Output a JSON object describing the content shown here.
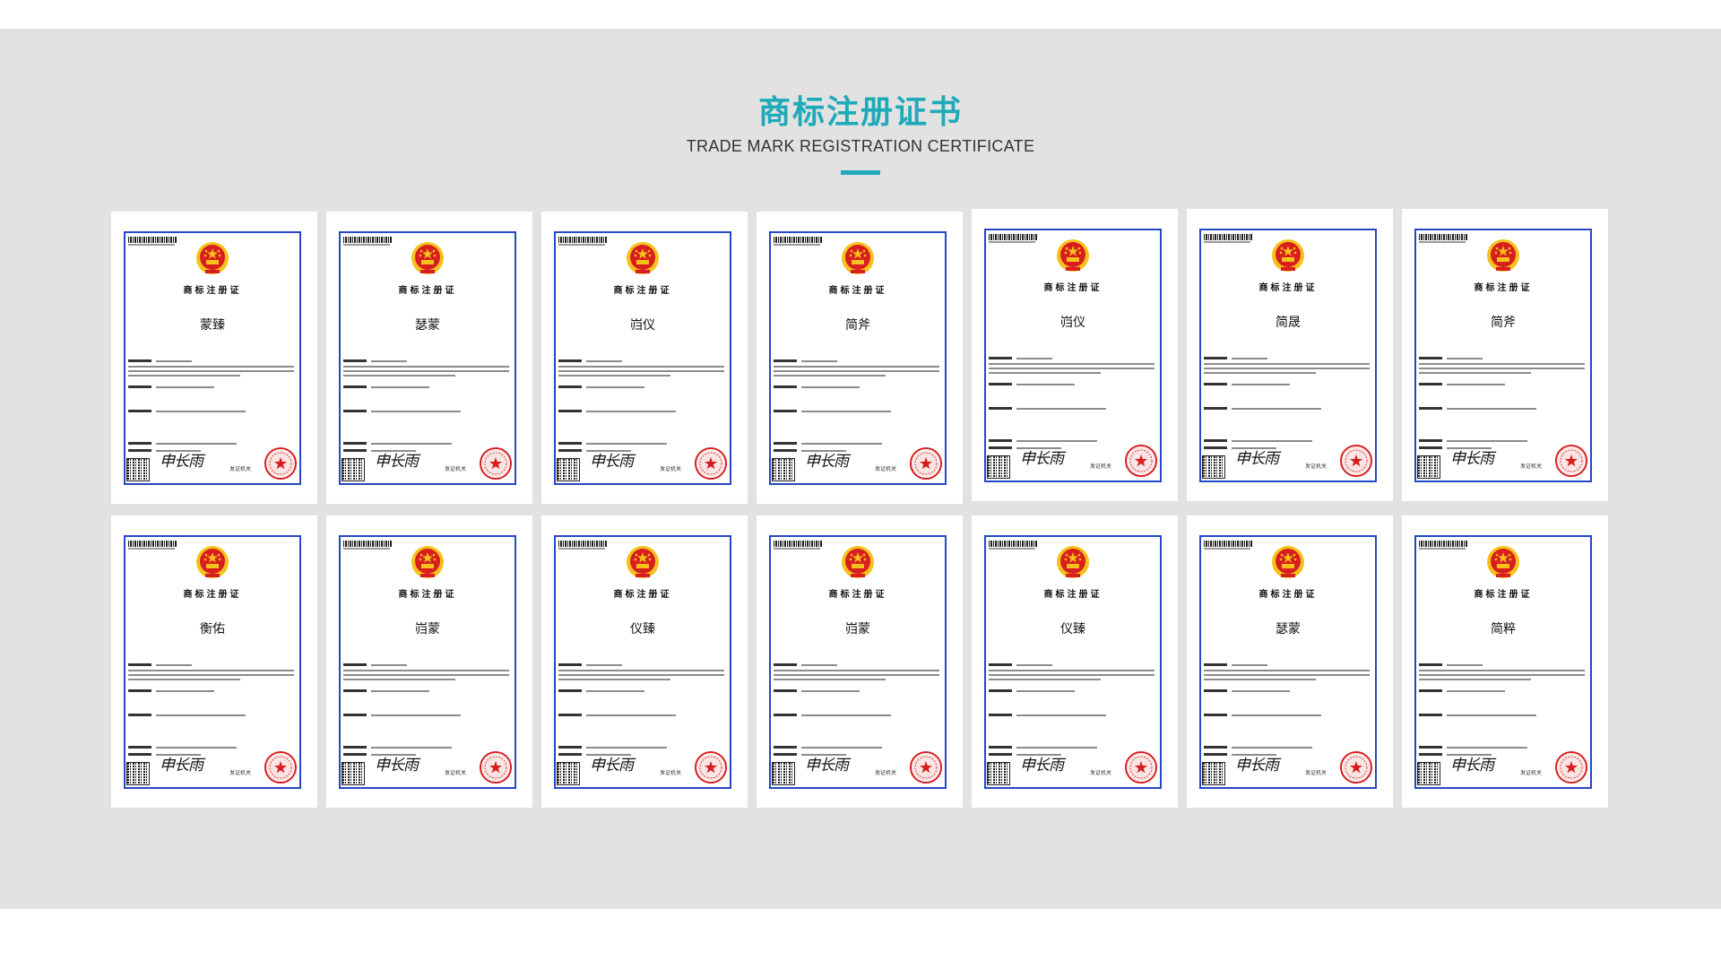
{
  "header": {
    "title_cn": "商标注册证书",
    "title_en": "TRADE MARK REGISTRATION CERTIFICATE"
  },
  "colors": {
    "accent": "#1eaab8",
    "cert_border": "#2448c6",
    "seal_red": "#d81e1e",
    "background_band": "#e2e2e2"
  },
  "certificate_template": {
    "heading": "商标注册证",
    "signature": "申长雨",
    "issuer": "发证机关",
    "emblem_icon": "national-emblem-icon",
    "seal_icon": "red-official-seal-icon",
    "qr_icon": "qr-code-icon"
  },
  "certificates": [
    {
      "mark": "蒙臻"
    },
    {
      "mark": "瑟蒙"
    },
    {
      "mark": "岿仪"
    },
    {
      "mark": "简斧"
    },
    {
      "mark": "岿仪"
    },
    {
      "mark": "简晟"
    },
    {
      "mark": "简斧"
    },
    {
      "mark": "衡佑"
    },
    {
      "mark": "岿蒙"
    },
    {
      "mark": "仪臻"
    },
    {
      "mark": "岿蒙"
    },
    {
      "mark": "仪臻"
    },
    {
      "mark": "瑟蒙"
    },
    {
      "mark": "简粹"
    }
  ]
}
